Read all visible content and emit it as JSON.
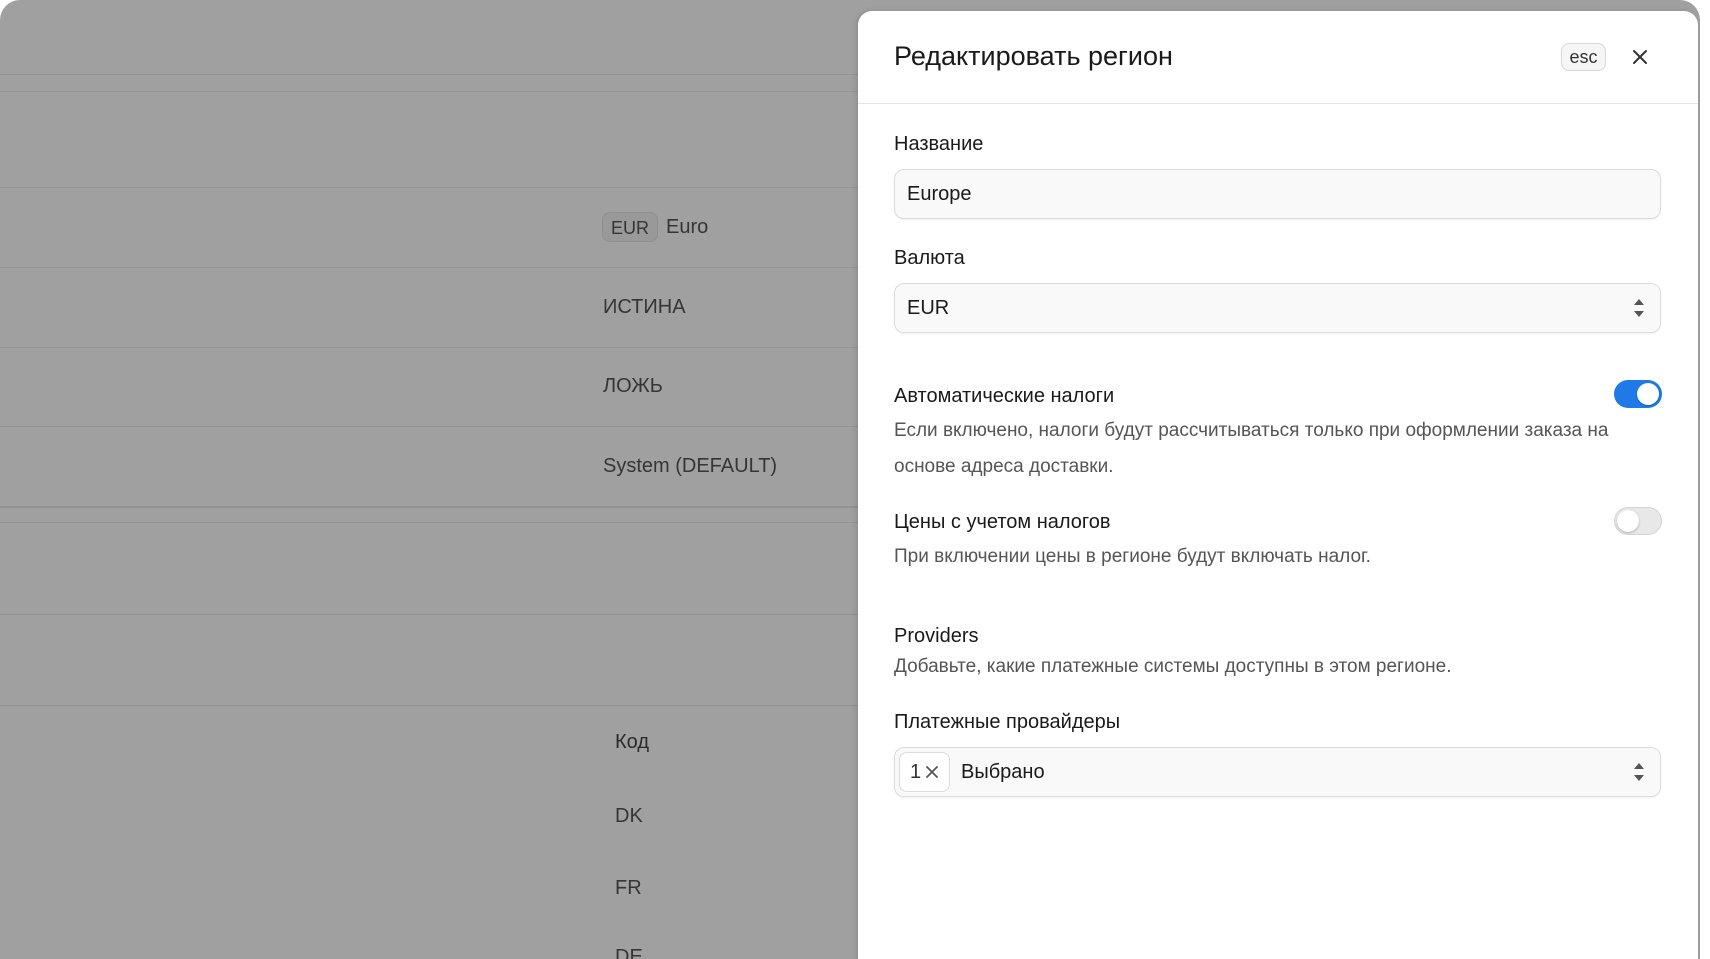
{
  "background": {
    "currency_code": "EUR",
    "currency_name": "Euro",
    "automatic_taxes_value": "ИСТИНА",
    "tax_inclusive_value": "ЛОЖЬ",
    "tax_provider_value": "System (DEFAULT)",
    "countries_column_header": "Код",
    "countries": [
      "DK",
      "FR",
      "DE"
    ]
  },
  "drawer": {
    "title": "Редактировать регион",
    "esc_label": "esc",
    "close_icon": "close-icon",
    "name": {
      "label": "Название",
      "value": "Europe"
    },
    "currency": {
      "label": "Валюта",
      "value": "EUR"
    },
    "automatic_taxes": {
      "label": "Автоматические налоги",
      "description": "Если включено, налоги будут рассчитываться только при оформлении заказа на основе адреса доставки.",
      "enabled": true
    },
    "tax_inclusive": {
      "label": "Цены с учетом налогов",
      "description": "При включении цены в регионе будут включать налог.",
      "enabled": false
    },
    "providers": {
      "heading": "Providers",
      "description": "Добавьте, какие платежные системы доступны в этом регионе.",
      "payment_label": "Платежные провайдеры",
      "selected_count": "1",
      "selected_text": "Выбрано"
    },
    "accent_color": "#1f7ae8"
  }
}
